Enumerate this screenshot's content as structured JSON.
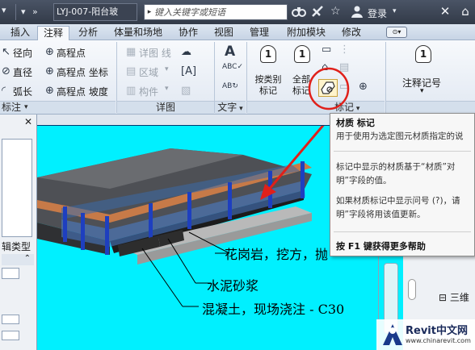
{
  "titlebar": {
    "title": "LYJ-007-阳台玻",
    "search_placeholder": "键入关键字或短语",
    "login_label": "登录",
    "icons": [
      "binoculars-icon",
      "satellite-icon",
      "star-icon",
      "user-icon",
      "close-icon",
      "help-icon"
    ]
  },
  "tabs": [
    {
      "label": "插入"
    },
    {
      "label": "注释",
      "active": true
    },
    {
      "label": "分析"
    },
    {
      "label": "体量和场地"
    },
    {
      "label": "协作"
    },
    {
      "label": "视图"
    },
    {
      "label": "管理"
    },
    {
      "label": "附加模块"
    },
    {
      "label": "修改"
    }
  ],
  "ribbon": {
    "dimension": {
      "radial": "径向",
      "diameter": "直径",
      "arc_length": "弧长",
      "spot_elevation": "高程点",
      "spot_coordinate": "高程点 坐标",
      "spot_slope": "高程点 坡度",
      "panel_label": "标注"
    },
    "detail": {
      "detail_line": "详图 线",
      "region": "区域",
      "component": "构件",
      "panel_label": "详图"
    },
    "text": {
      "text_button": "文字",
      "panel_label": "文字"
    },
    "tag": {
      "tag_by_category": "按类别 标记",
      "tag_all": "全部 标记",
      "panel_label": "标记",
      "tag_number_1": "1"
    },
    "keynote": {
      "label": "注释记号"
    }
  },
  "tooltip": {
    "title": "材质 标记",
    "line1": "用于使用为选定图元材质指定的说",
    "line2": "标记中显示的材质基于“材质”对",
    "line3": "明”字段的值。",
    "line4": "如果材质标记中显示问号 (?)，请",
    "line5": "明”字段将用该值更新。",
    "f1": "按 F1 键获得更多帮助"
  },
  "left_panel": {
    "label": "辑类型"
  },
  "right_panel": {
    "item": "三维"
  },
  "drawing": {
    "annotation1": "花岗岩，挖方，抛",
    "annotation2": "水泥砂浆",
    "annotation3": "混凝土，现场浇注 - C30"
  },
  "watermark": {
    "title": "Revit中文网",
    "url": "www.chinarevit.com"
  },
  "colors": {
    "canvas": "#00f0ff",
    "highlight_circle": "#e0201a",
    "arrow": "#e0201a"
  }
}
